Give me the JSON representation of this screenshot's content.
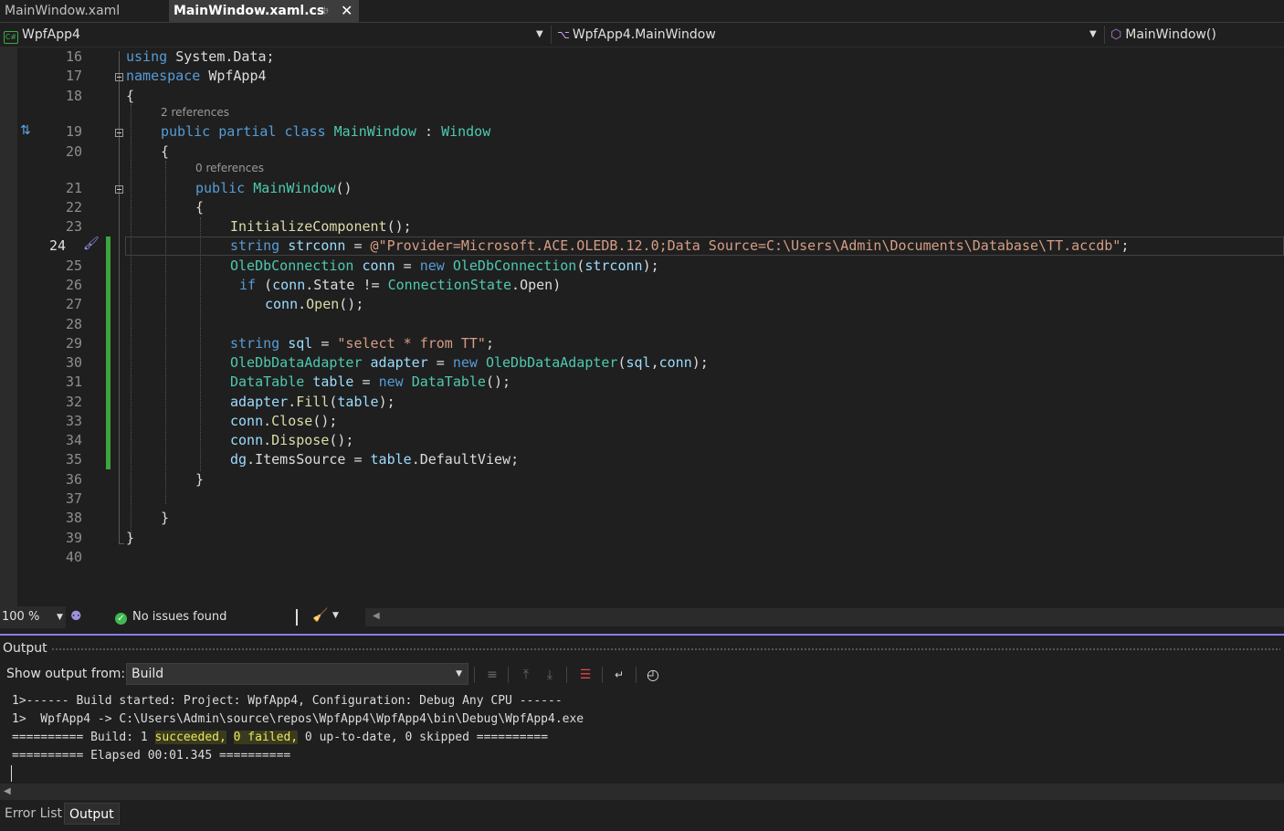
{
  "tabs": [
    {
      "label": "MainWindow.xaml",
      "active": false
    },
    {
      "label": "MainWindow.xaml.cs",
      "active": true
    }
  ],
  "nav": {
    "project": "WpfApp4",
    "type": "WpfApp4.MainWindow",
    "member": "MainWindow()"
  },
  "editor": {
    "line_numbers": [
      "16",
      "17",
      "18",
      "19",
      "20",
      "21",
      "22",
      "23",
      "24",
      "25",
      "26",
      "27",
      "28",
      "29",
      "30",
      "31",
      "32",
      "33",
      "34",
      "35",
      "36",
      "37",
      "38",
      "39",
      "40"
    ],
    "current_line": "24",
    "codelens": {
      "class_refs": "2 references",
      "ctor_refs": "0 references"
    },
    "code": {
      "l16": [
        "using",
        "System",
        ".",
        "Data",
        ";"
      ],
      "l17": [
        "namespace",
        "WpfApp4"
      ],
      "l18": [
        "{"
      ],
      "l19": [
        "public",
        "partial",
        "class",
        "MainWindow",
        ":",
        "Window"
      ],
      "l20": [
        "{"
      ],
      "l21": [
        "public",
        "MainWindow",
        "()"
      ],
      "l22": [
        "{"
      ],
      "l23": [
        "InitializeComponent",
        "();"
      ],
      "l24": [
        "string",
        "strconn",
        "=",
        "@\"Provider=Microsoft.ACE.OLEDB.12.0;Data Source=C:\\Users\\Admin\\Documents\\Database\\TT.accdb\"",
        ";"
      ],
      "l25": [
        "OleDbConnection",
        "conn",
        "=",
        "new",
        "OleDbConnection",
        "(",
        "strconn",
        ");"
      ],
      "l26": [
        "if",
        "(",
        "conn",
        ".",
        "State",
        "!=",
        "ConnectionState",
        ".",
        "Open",
        ")"
      ],
      "l27": [
        "conn",
        ".",
        "Open",
        "();"
      ],
      "l29": [
        "string",
        "sql",
        "=",
        "\"select * from TT\"",
        ";"
      ],
      "l30": [
        "OleDbDataAdapter",
        "adapter",
        "=",
        "new",
        "OleDbDataAdapter",
        "(",
        "sql",
        ",",
        "conn",
        ");"
      ],
      "l31": [
        "DataTable",
        "table",
        "=",
        "new",
        "DataTable",
        "();"
      ],
      "l32": [
        "adapter",
        ".",
        "Fill",
        "(",
        "table",
        ");"
      ],
      "l33": [
        "conn",
        ".",
        "Close",
        "();"
      ],
      "l34": [
        "conn",
        ".",
        "Dispose",
        "();"
      ],
      "l35": [
        "dg",
        ".",
        "ItemsSource",
        "=",
        "table",
        ".",
        "DefaultView",
        ";"
      ],
      "l36": [
        "}"
      ],
      "l38": [
        "}"
      ],
      "l39": [
        "}"
      ]
    }
  },
  "editor_status": {
    "zoom": "100 %",
    "issues": "No issues found"
  },
  "output": {
    "title": "Output",
    "show_from_label": "Show output from:",
    "source": "Build",
    "lines": [
      "1>------ Build started: Project: WpfApp4, Configuration: Debug Any CPU ------",
      "1>  WpfApp4 -> C:\\Users\\Admin\\source\\repos\\WpfApp4\\WpfApp4\\bin\\Debug\\WpfApp4.exe"
    ],
    "build_summary": {
      "prefix": "========== Build: 1 ",
      "succeeded": "succeeded,",
      "space": " ",
      "failed": "0 failed,",
      "suffix": " 0 up-to-date, 0 skipped =========="
    },
    "elapsed": "========== Elapsed 00:01.345 =========="
  },
  "bottom_tabs": [
    {
      "label": "Error List",
      "active": false
    },
    {
      "label": "Output",
      "active": true
    }
  ],
  "colors": {
    "keyword": "#569cd6",
    "type": "#4ec9b0",
    "method": "#dcdcaa",
    "variable": "#9cdcfe",
    "string": "#d69d85",
    "change_bar": "#3ca53c",
    "panel_accent": "#8a7ef5"
  }
}
